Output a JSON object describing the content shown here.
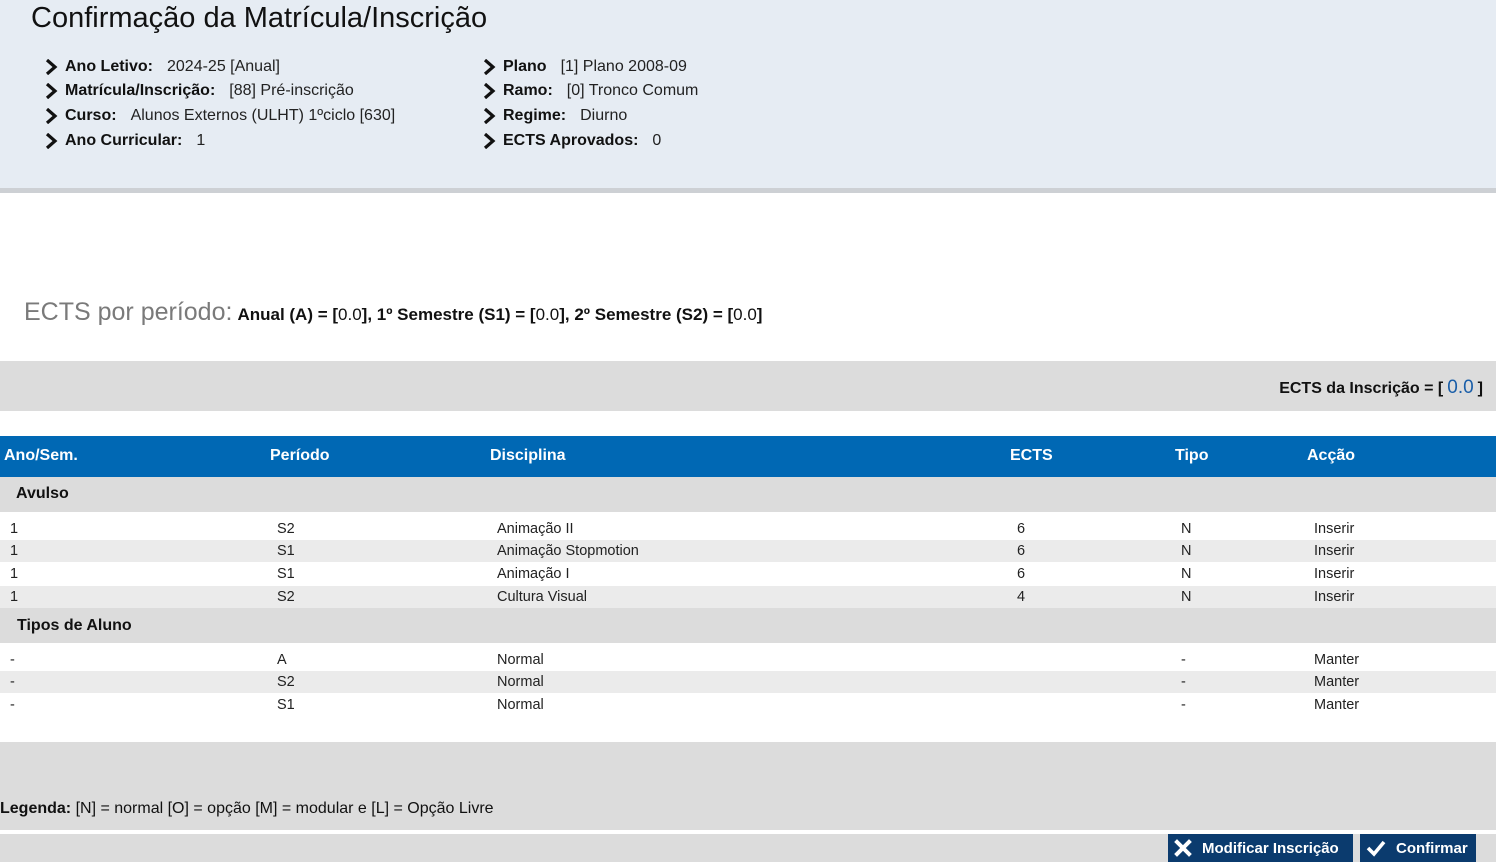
{
  "page_title": "Confirmação da Matrícula/Inscrição",
  "info_left": [
    {
      "label": "Ano Letivo:",
      "value": "2024-25 [Anual]"
    },
    {
      "label": "Matrícula/Inscrição:",
      "value": "[88] Pré-inscrição"
    },
    {
      "label": "Curso:",
      "value": "Alunos Externos (ULHT) 1ºciclo [630]"
    },
    {
      "label": "Ano Curricular:",
      "value": "1"
    }
  ],
  "info_right": [
    {
      "label": "Plano",
      "value": "[1] Plano 2008-09"
    },
    {
      "label": "Ramo:",
      "value": "[0] Tronco Comum"
    },
    {
      "label": "Regime:",
      "value": "Diurno"
    },
    {
      "label": "ECTS Aprovados:",
      "value": "0"
    }
  ],
  "ects_period": {
    "heading": "ECTS por período:",
    "anual_label": "Anual (A) = [",
    "anual_value": "0.0",
    "s1_label": "], 1º Semestre (S1) = [",
    "s1_value": "0.0",
    "s2_label": "], 2º Semestre (S2) = [",
    "s2_value": "0.0",
    "close": "]"
  },
  "ects_inscricao": {
    "label": "ECTS da Inscrição = [",
    "value": "0.0",
    "close": "]"
  },
  "table": {
    "headers": [
      "Ano/Sem.",
      "Período",
      "Disciplina",
      "ECTS",
      "Tipo",
      "Acção"
    ],
    "groups": [
      {
        "name": "Avulso",
        "rows": [
          [
            "1",
            "S2",
            "Animação II",
            "6",
            "N",
            "Inserir"
          ],
          [
            "1",
            "S1",
            "Animação Stopmotion",
            "6",
            "N",
            "Inserir"
          ],
          [
            "1",
            "S1",
            "Animação I",
            "6",
            "N",
            "Inserir"
          ],
          [
            "1",
            "S2",
            "Cultura Visual",
            "4",
            "N",
            "Inserir"
          ]
        ]
      },
      {
        "name": "Tipos de Aluno",
        "rows": [
          [
            "-",
            "A",
            "Normal",
            "",
            "-",
            "Manter"
          ],
          [
            "-",
            "S2",
            "Normal",
            "",
            "-",
            "Manter"
          ],
          [
            "-",
            "S1",
            "Normal",
            "",
            "-",
            "Manter"
          ]
        ]
      }
    ]
  },
  "legend": {
    "label": "Legenda:",
    "text": " [N] = normal [O] = opção [M] = modular e [L] = Opção Livre"
  },
  "buttons": {
    "modify": "Modificar Inscrição",
    "confirm": "Confirmar"
  },
  "icons": {
    "bullet": "chevron-right-icon",
    "modify": "close-icon",
    "confirm": "check-icon"
  },
  "colors": {
    "header_bg": "#e6ecf3",
    "table_header": "#0068b4",
    "button": "#0b3b6e",
    "value_accent": "#1a5ea8"
  }
}
